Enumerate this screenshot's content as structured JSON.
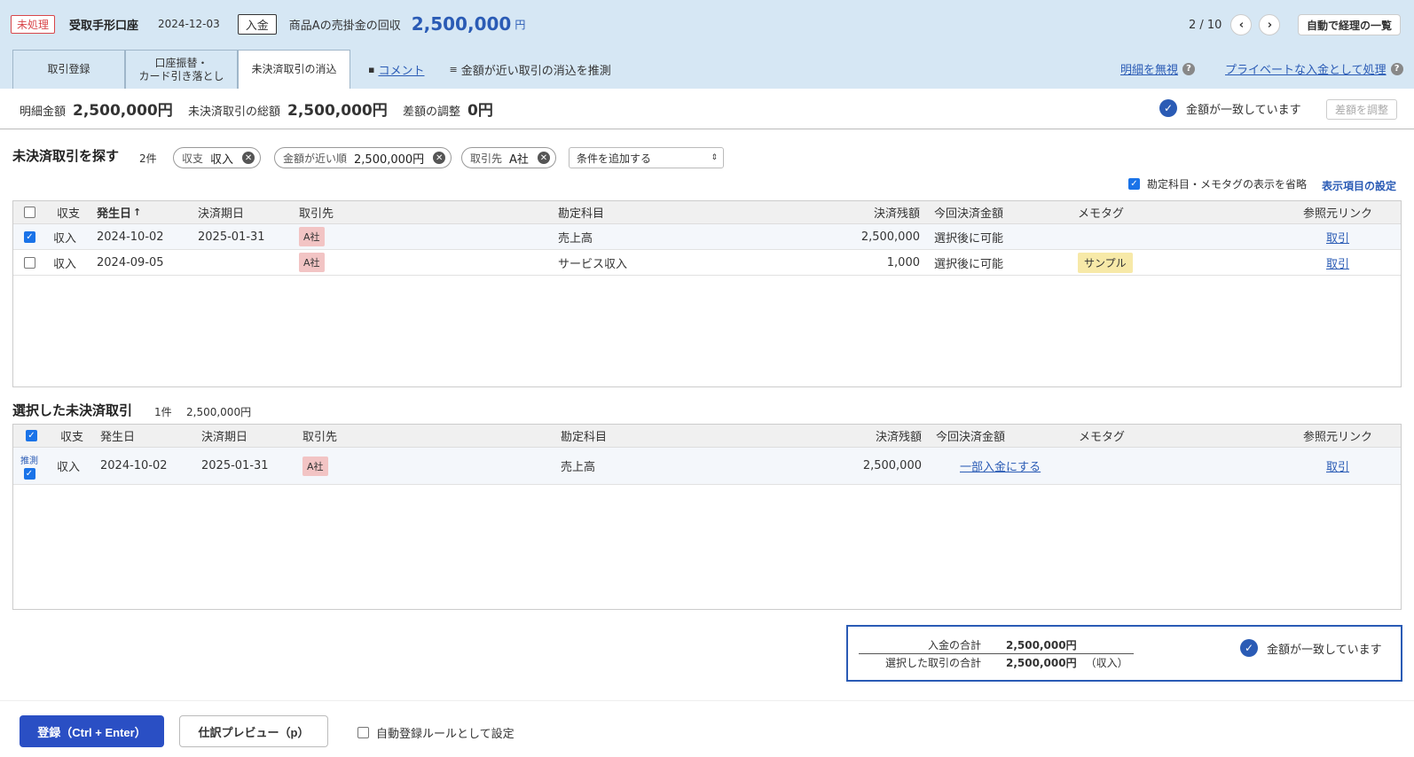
{
  "header": {
    "status_badge": "未処理",
    "account": "受取手形口座",
    "date": "2024-12-03",
    "type_badge": "入金",
    "description": "商品Aの売掛金の回収",
    "amount": "2,500,000",
    "currency": "円",
    "pager": "2 / 10",
    "prev_icon": "‹",
    "next_icon": "›",
    "auto_list_button": "自動で経理の一覧"
  },
  "tabs": [
    {
      "label": "取引登録"
    },
    {
      "label": "口座振替・\nカード引き落とし"
    },
    {
      "label": "未決済取引の消込"
    }
  ],
  "tab_links": {
    "comment": "コメント",
    "guess": "金額が近い取引の消込を推測",
    "ignore": "明細を無視",
    "private": "プライベートな入金として処理",
    "help": "?"
  },
  "summary": {
    "detail_label": "明細金額",
    "detail_value": "2,500,000円",
    "total_label": "未決済取引の総額",
    "total_value": "2,500,000円",
    "diff_label": "差額の調整",
    "diff_value": "0円",
    "match_text": "金額が一致しています",
    "adjust_button": "差額を調整"
  },
  "search": {
    "title": "未決済取引を探す",
    "count": "2件",
    "chips": [
      {
        "key": "収支",
        "value": "収入"
      },
      {
        "key": "金額が近い順",
        "value": "2,500,000円"
      },
      {
        "key": "取引先",
        "value": "A社"
      }
    ],
    "add_condition": "条件を追加する",
    "omit_option": "勘定科目・メモタグの表示を省略",
    "display_settings": "表示項目の設定"
  },
  "columns": {
    "type": "収支",
    "issue_date": "発生日",
    "due_date": "決済期日",
    "partner": "取引先",
    "account": "勘定科目",
    "balance": "決済残額",
    "current": "今回決済金額",
    "memo": "メモタグ",
    "ref": "参照元リンク",
    "sort_icon": "↑"
  },
  "rows": [
    {
      "checked": true,
      "type": "収入",
      "issue_date": "2024-10-02",
      "due_date": "2025-01-31",
      "partner": "A社",
      "account": "売上高",
      "balance": "2,500,000",
      "current": "選択後に可能",
      "memo": "",
      "ref": "取引"
    },
    {
      "checked": false,
      "type": "収入",
      "issue_date": "2024-09-05",
      "due_date": "",
      "partner": "A社",
      "account": "サービス収入",
      "balance": "1,000",
      "current": "選択後に可能",
      "memo": "サンプル",
      "ref": "取引"
    }
  ],
  "selected": {
    "title": "選択した未決済取引",
    "count": "1件",
    "amount": "2,500,000円",
    "rows": [
      {
        "guess": "推測",
        "type": "収入",
        "issue_date": "2024-10-02",
        "due_date": "2025-01-31",
        "partner": "A社",
        "account": "売上高",
        "balance": "2,500,000",
        "current": "一部入金にする",
        "memo": "",
        "ref": "取引"
      }
    ]
  },
  "totals": {
    "deposit_label": "入金の合計",
    "deposit_value": "2,500,000円",
    "selected_label": "選択した取引の合計",
    "selected_value": "2,500,000円",
    "selected_suffix": "（収入）",
    "match_text": "金額が一致しています"
  },
  "footer": {
    "register": "登録（Ctrl + Enter）",
    "preview": "仕訳プレビュー（p）",
    "auto_rule": "自動登録ルールとして設定"
  },
  "colors": {
    "accent": "#2a5bb5",
    "header_bg": "#d6e7f4",
    "primary_button": "#2a4fc4",
    "status_red": "#d8464a"
  }
}
